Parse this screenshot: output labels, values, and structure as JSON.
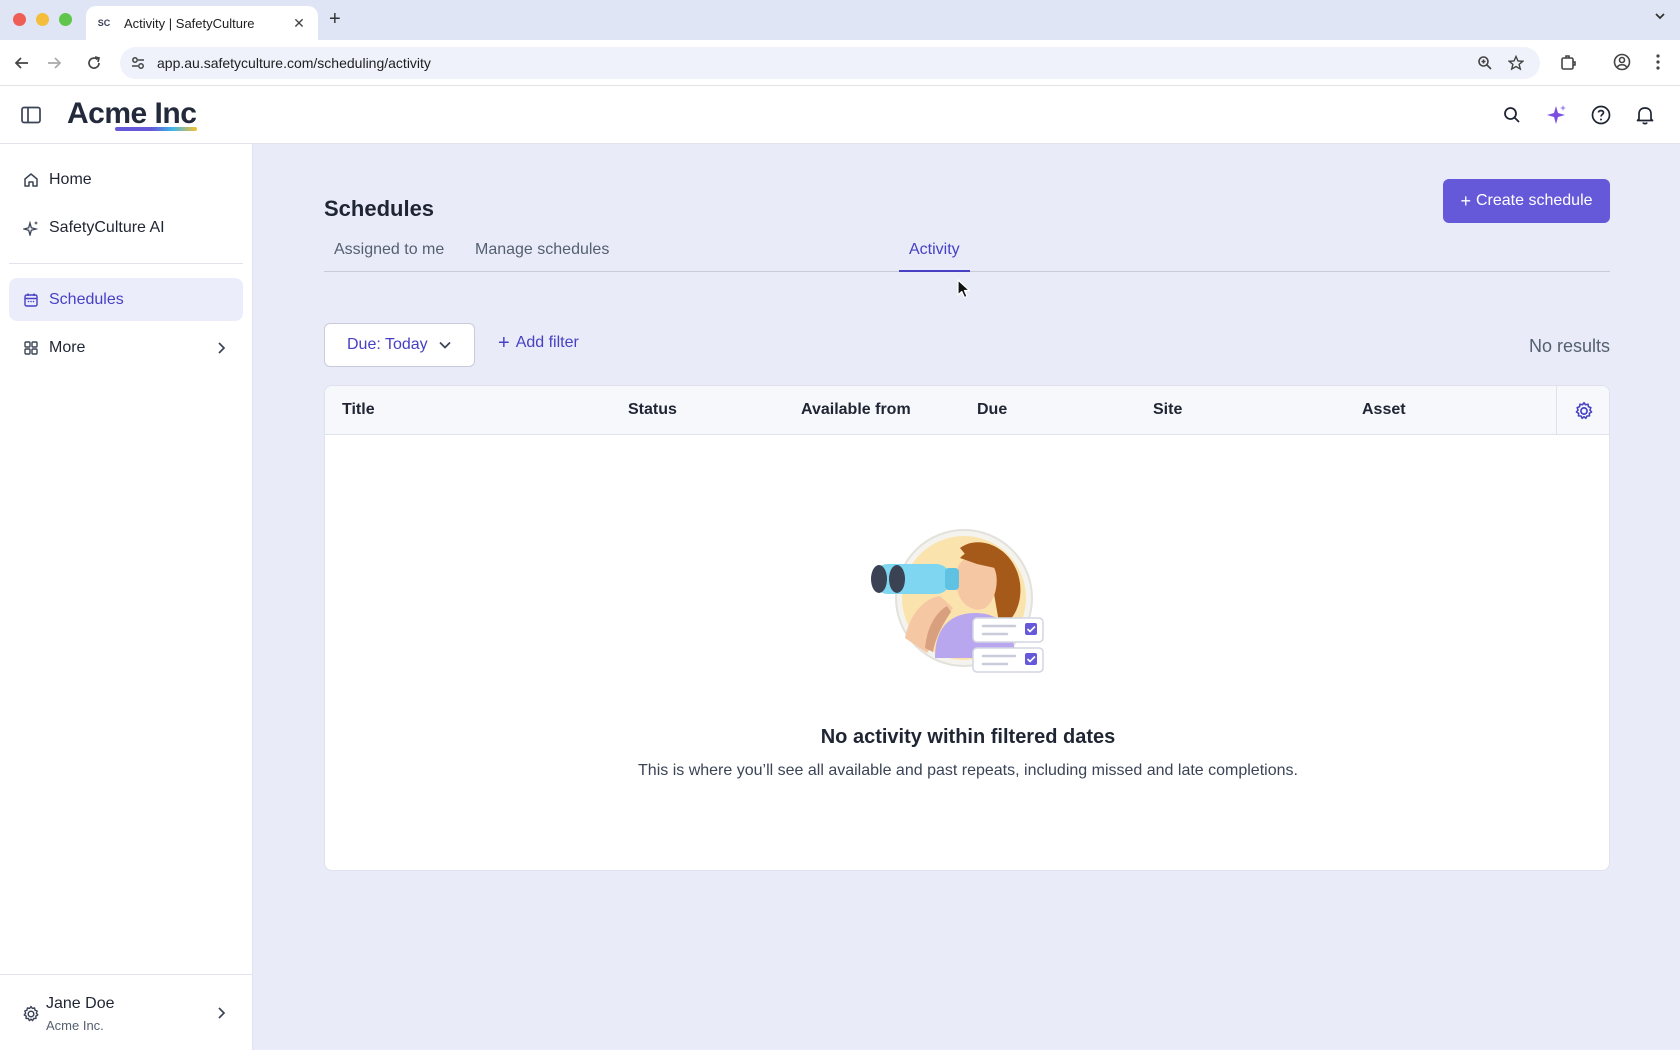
{
  "browser": {
    "tab_title": "Activity | SafetyCulture",
    "favicon_text": "SC",
    "url": "app.au.safetyculture.com/scheduling/activity"
  },
  "header": {
    "logo": "Acme Inc"
  },
  "sidebar": {
    "items": [
      {
        "label": "Home",
        "icon": "home-icon"
      },
      {
        "label": "SafetyCulture AI",
        "icon": "sparkle-icon"
      },
      {
        "label": "Schedules",
        "icon": "calendar-icon",
        "active": true
      },
      {
        "label": "More",
        "icon": "grid-icon"
      }
    ],
    "user": {
      "name": "Jane Doe",
      "org": "Acme Inc."
    }
  },
  "main": {
    "title": "Schedules",
    "create_button": "Create schedule",
    "tabs": [
      {
        "label": "Assigned to me"
      },
      {
        "label": "Manage schedules"
      },
      {
        "label": "Activity",
        "active": true
      }
    ],
    "filter": {
      "label": "Due: Today"
    },
    "add_filter": "Add filter",
    "results_text": "No results",
    "table": {
      "columns": [
        "Title",
        "Status",
        "Available from",
        "Due",
        "Site",
        "Asset"
      ]
    },
    "empty_state": {
      "title": "No activity within filtered dates",
      "description": "This is where you’ll see all available and past repeats, including missed and late completions."
    }
  },
  "colors": {
    "accent": "#6559d9",
    "active_text": "#4740c4",
    "main_bg": "#e9ecf8"
  }
}
